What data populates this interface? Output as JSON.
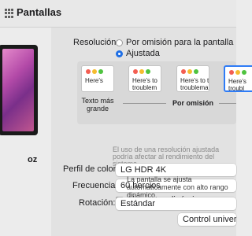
{
  "window": {
    "title": "Pantallas"
  },
  "sidebar": {
    "display_name": "oz"
  },
  "resolution": {
    "label": "Resolución:",
    "options": [
      {
        "label": "Por omisión para la pantalla",
        "selected": false
      },
      {
        "label": "Ajustada",
        "selected": true
      }
    ],
    "scales": [
      {
        "text": "Here's",
        "label": "Texto más\ngrande",
        "selected": false
      },
      {
        "text": "Here's to\ntroublem",
        "label": "",
        "selected": false
      },
      {
        "text": "Here's to t\ntroublemak\nones who",
        "label": "",
        "selected": false
      },
      {
        "text": "Here's\ntroubl\nrebels",
        "label": "",
        "selected": true
      }
    ],
    "default_label": "Por omisión",
    "note": "El uso de una resolución ajustada podría afectar al rendimiento del sistema."
  },
  "color_profile": {
    "label": "Perfil de color:",
    "value": "LG HDR 4K"
  },
  "refresh": {
    "label": "Frecuencia:",
    "value": "60 hercios"
  },
  "hdr": {
    "label": "Alto rango dinámico",
    "checked": false,
    "note": "La pantalla se ajusta automáticamente con alto rango dinámico."
  },
  "rotation": {
    "label": "Rotación:",
    "value": "Estándar"
  },
  "universal_control_button": "Control universal",
  "colors": {
    "accent": "#1f6fe5"
  }
}
